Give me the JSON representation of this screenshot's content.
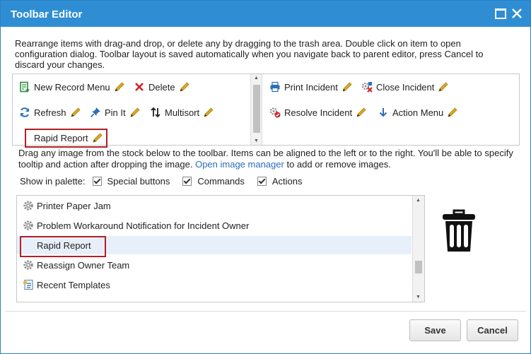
{
  "window": {
    "title": "Toolbar Editor"
  },
  "intro": "Rearrange items with drag-and drop, or delete any by dragging to the trash area. Double click on item to open configuration dialog. Toolbar layout is saved automatically when you navigate back to parent editor, press Cancel to discard your changes.",
  "toolbar": {
    "left_items": [
      {
        "label": "New Record Menu",
        "icon": "new-record-icon"
      },
      {
        "label": "Delete",
        "icon": "delete-x-icon"
      },
      {
        "label": "Refresh",
        "icon": "refresh-icon"
      },
      {
        "label": "Pin It",
        "icon": "pin-icon"
      },
      {
        "label": "Multisort",
        "icon": "sort-icon"
      },
      {
        "label": "Rapid Report",
        "icon": ""
      }
    ],
    "right_items": [
      {
        "label": "Print Incident",
        "icon": "printer-icon"
      },
      {
        "label": "Close Incident",
        "icon": "close-incident-icon"
      },
      {
        "label": "Resolve Incident",
        "icon": "resolve-icon"
      },
      {
        "label": "Action Menu",
        "icon": "arrow-down-icon"
      }
    ]
  },
  "hint": {
    "text_before": "Drag any image from the stock below to the toolbar. Items can be aligned to the left or to the right. You'll be able to specify tooltip and action after dropping the image.",
    "link": "Open image manager",
    "text_after": "to add or remove images."
  },
  "palette": {
    "label": "Show in palette:",
    "options": [
      {
        "label": "Special buttons",
        "checked": true
      },
      {
        "label": "Commands",
        "checked": true
      },
      {
        "label": "Actions",
        "checked": true
      }
    ]
  },
  "stock": {
    "items": [
      {
        "label": "Printer Paper Jam",
        "icon": "gear-icon",
        "selected": false
      },
      {
        "label": "Problem Workaround Notification for Incident Owner",
        "icon": "gear-icon",
        "selected": false
      },
      {
        "label": "Rapid Report",
        "icon": "",
        "selected": true
      },
      {
        "label": "Reassign Owner Team",
        "icon": "gear-icon",
        "selected": false
      },
      {
        "label": "Recent Templates",
        "icon": "templates-icon",
        "selected": false
      }
    ]
  },
  "buttons": {
    "save": "Save",
    "cancel": "Cancel"
  },
  "colors": {
    "titlebar": "#2f8ed3",
    "highlight_border": "#b21f24",
    "selection": "#e7f0fa",
    "link": "#2a6ebb",
    "pencil": "#e0a81a"
  }
}
